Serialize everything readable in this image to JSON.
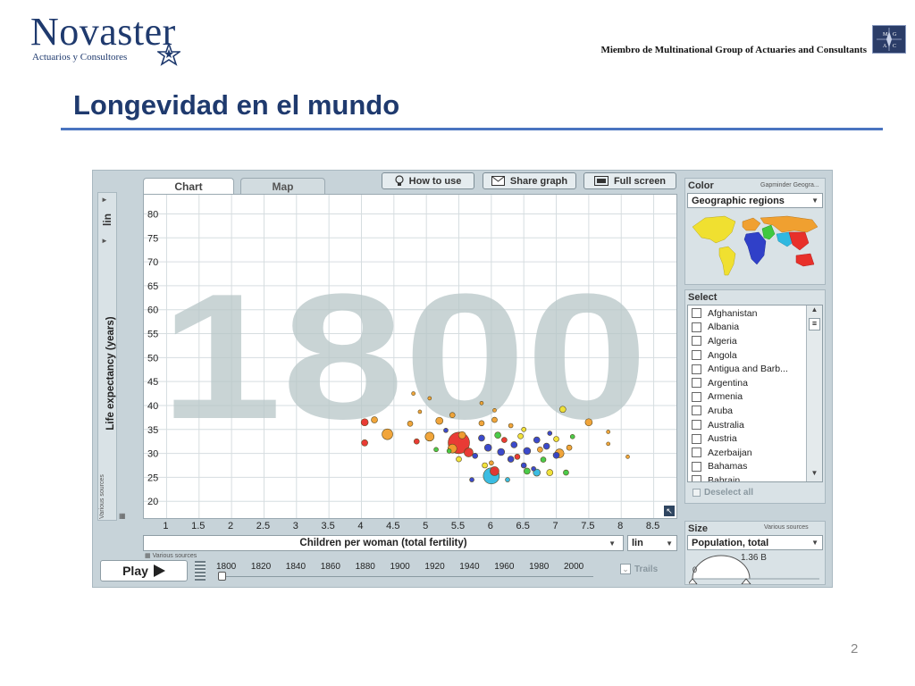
{
  "header": {
    "logo_word": "Novaster",
    "logo_sub": "Actuarios y Consultores",
    "member_text": "Miembro de Multinational Group of Actuaries and Consultants",
    "mgac_letters": [
      "M",
      "G",
      "A",
      "C"
    ]
  },
  "slide": {
    "title": "Longevidad en el mundo",
    "page_number": "2"
  },
  "app": {
    "tabs": [
      "Chart",
      "Map"
    ],
    "toolbar": {
      "how_to_use": "How to use",
      "share_graph": "Share graph",
      "full_screen": "Full screen"
    },
    "scale_y": "lin",
    "y_axis_label": "Life expectancy (years)",
    "y_sources": "Various sources",
    "x_axis_label": "Children per woman (total fertility)",
    "x_sources": "Various sources",
    "scale_x": "lin",
    "watermark_year": "1800",
    "play_label": "Play",
    "timeline_years": [
      "1800",
      "1820",
      "1840",
      "1860",
      "1880",
      "1900",
      "1920",
      "1940",
      "1960",
      "1980",
      "2000"
    ],
    "trails_label": "Trails",
    "color": {
      "heading": "Color",
      "source": "Gapminder Geogra...",
      "value": "Geographic regions"
    },
    "select": {
      "heading": "Select",
      "countries": [
        "Afghanistan",
        "Albania",
        "Algeria",
        "Angola",
        "Antigua and Barb...",
        "Argentina",
        "Armenia",
        "Aruba",
        "Australia",
        "Austria",
        "Azerbaijan",
        "Bahamas",
        "Bahrain"
      ],
      "deselect_all": "Deselect all"
    },
    "size": {
      "heading": "Size",
      "source": "Various sources",
      "value": "Population, total",
      "gauge_min": "0",
      "gauge_max": "1.36 B"
    },
    "colors": {
      "red": "#e8302a",
      "orange": "#f0a030",
      "blue": "#3040c8",
      "yellow": "#f0e030",
      "green": "#40c840",
      "cyan": "#30b8e0"
    }
  },
  "chart_data": {
    "type": "scatter",
    "xlabel": "Children per woman (total fertility)",
    "ylabel": "Life expectancy (years)",
    "xticks": [
      "1",
      "1.5",
      "2",
      "2.5",
      "3",
      "3.5",
      "4",
      "4.5",
      "5",
      "5.5",
      "6",
      "6.5",
      "7",
      "7.5",
      "8",
      "8.5"
    ],
    "yticks": [
      "20",
      "25",
      "30",
      "35",
      "40",
      "45",
      "50",
      "55",
      "60",
      "65",
      "70",
      "75",
      "80"
    ],
    "xlim": [
      0.65,
      8.85
    ],
    "ylim": [
      16.5,
      84
    ],
    "grid": true,
    "points": [
      {
        "x": 5.5,
        "y": 32.2,
        "c": "red",
        "s": 12
      },
      {
        "x": 6.0,
        "y": 25.3,
        "c": "cyan",
        "s": 9
      },
      {
        "x": 4.4,
        "y": 34.0,
        "c": "orange",
        "s": 6
      },
      {
        "x": 4.05,
        "y": 36.5,
        "c": "red",
        "s": 4
      },
      {
        "x": 4.05,
        "y": 32.2,
        "c": "red",
        "s": 3.5
      },
      {
        "x": 4.2,
        "y": 37.0,
        "c": "orange",
        "s": 3.5
      },
      {
        "x": 5.05,
        "y": 33.5,
        "c": "orange",
        "s": 5
      },
      {
        "x": 5.55,
        "y": 33.8,
        "c": "orange",
        "s": 4
      },
      {
        "x": 6.05,
        "y": 26.3,
        "c": "red",
        "s": 5
      },
      {
        "x": 5.4,
        "y": 31.0,
        "c": "orange",
        "s": 5
      },
      {
        "x": 5.65,
        "y": 30.2,
        "c": "red",
        "s": 5
      },
      {
        "x": 6.7,
        "y": 26.0,
        "c": "cyan",
        "s": 4
      },
      {
        "x": 7.05,
        "y": 30.0,
        "c": "orange",
        "s": 5
      },
      {
        "x": 7.5,
        "y": 36.5,
        "c": "orange",
        "s": 4
      },
      {
        "x": 7.1,
        "y": 39.2,
        "c": "yellow",
        "s": 3.5
      },
      {
        "x": 5.2,
        "y": 36.8,
        "c": "orange",
        "s": 4
      },
      {
        "x": 5.4,
        "y": 38.0,
        "c": "orange",
        "s": 3
      },
      {
        "x": 4.75,
        "y": 36.2,
        "c": "orange",
        "s": 3
      },
      {
        "x": 4.85,
        "y": 32.5,
        "c": "red",
        "s": 3
      },
      {
        "x": 5.85,
        "y": 36.3,
        "c": "orange",
        "s": 3
      },
      {
        "x": 6.05,
        "y": 37.0,
        "c": "orange",
        "s": 3
      },
      {
        "x": 5.85,
        "y": 33.2,
        "c": "blue",
        "s": 3.5
      },
      {
        "x": 5.95,
        "y": 31.2,
        "c": "blue",
        "s": 4
      },
      {
        "x": 6.15,
        "y": 30.3,
        "c": "blue",
        "s": 4
      },
      {
        "x": 6.35,
        "y": 31.8,
        "c": "blue",
        "s": 3.5
      },
      {
        "x": 6.55,
        "y": 30.5,
        "c": "blue",
        "s": 4
      },
      {
        "x": 6.7,
        "y": 32.8,
        "c": "blue",
        "s": 3.5
      },
      {
        "x": 6.85,
        "y": 31.5,
        "c": "blue",
        "s": 3.5
      },
      {
        "x": 7.0,
        "y": 29.6,
        "c": "blue",
        "s": 3.5
      },
      {
        "x": 6.3,
        "y": 28.8,
        "c": "blue",
        "s": 3.5
      },
      {
        "x": 6.5,
        "y": 27.5,
        "c": "blue",
        "s": 3
      },
      {
        "x": 5.75,
        "y": 29.5,
        "c": "blue",
        "s": 3
      },
      {
        "x": 6.1,
        "y": 33.8,
        "c": "green",
        "s": 3.5
      },
      {
        "x": 6.55,
        "y": 26.3,
        "c": "green",
        "s": 3.5
      },
      {
        "x": 6.8,
        "y": 28.7,
        "c": "green",
        "s": 3
      },
      {
        "x": 6.9,
        "y": 26.0,
        "c": "yellow",
        "s": 3.5
      },
      {
        "x": 7.0,
        "y": 33.0,
        "c": "yellow",
        "s": 3
      },
      {
        "x": 6.45,
        "y": 33.6,
        "c": "yellow",
        "s": 3
      },
      {
        "x": 5.5,
        "y": 28.8,
        "c": "yellow",
        "s": 3
      },
      {
        "x": 5.9,
        "y": 27.5,
        "c": "yellow",
        "s": 3
      },
      {
        "x": 6.2,
        "y": 32.8,
        "c": "red",
        "s": 3
      },
      {
        "x": 6.4,
        "y": 29.3,
        "c": "red",
        "s": 3
      },
      {
        "x": 6.75,
        "y": 30.8,
        "c": "orange",
        "s": 3
      },
      {
        "x": 7.2,
        "y": 31.2,
        "c": "orange",
        "s": 3
      },
      {
        "x": 7.15,
        "y": 26.0,
        "c": "green",
        "s": 3
      },
      {
        "x": 7.8,
        "y": 32.0,
        "c": "orange",
        "s": 2
      },
      {
        "x": 7.8,
        "y": 34.5,
        "c": "orange",
        "s": 2
      },
      {
        "x": 8.1,
        "y": 29.3,
        "c": "orange",
        "s": 2
      },
      {
        "x": 6.25,
        "y": 24.5,
        "c": "cyan",
        "s": 2.5
      },
      {
        "x": 6.65,
        "y": 26.8,
        "c": "blue",
        "s": 2.5
      },
      {
        "x": 5.7,
        "y": 24.5,
        "c": "blue",
        "s": 2.5
      },
      {
        "x": 4.9,
        "y": 38.7,
        "c": "orange",
        "s": 2
      },
      {
        "x": 4.8,
        "y": 42.5,
        "c": "orange",
        "s": 2
      },
      {
        "x": 5.85,
        "y": 40.5,
        "c": "orange",
        "s": 2
      },
      {
        "x": 5.05,
        "y": 41.5,
        "c": "orange",
        "s": 2
      },
      {
        "x": 6.05,
        "y": 39.0,
        "c": "orange",
        "s": 2
      },
      {
        "x": 6.3,
        "y": 35.8,
        "c": "orange",
        "s": 2.5
      },
      {
        "x": 6.5,
        "y": 35.0,
        "c": "yellow",
        "s": 2.5
      },
      {
        "x": 5.3,
        "y": 34.8,
        "c": "blue",
        "s": 2.5
      },
      {
        "x": 6.9,
        "y": 34.2,
        "c": "blue",
        "s": 2.5
      },
      {
        "x": 7.25,
        "y": 33.5,
        "c": "green",
        "s": 2.5
      },
      {
        "x": 6.0,
        "y": 28.0,
        "c": "orange",
        "s": 2.5
      },
      {
        "x": 5.35,
        "y": 30.5,
        "c": "green",
        "s": 2.5
      },
      {
        "x": 5.15,
        "y": 30.8,
        "c": "green",
        "s": 2.5
      }
    ]
  }
}
